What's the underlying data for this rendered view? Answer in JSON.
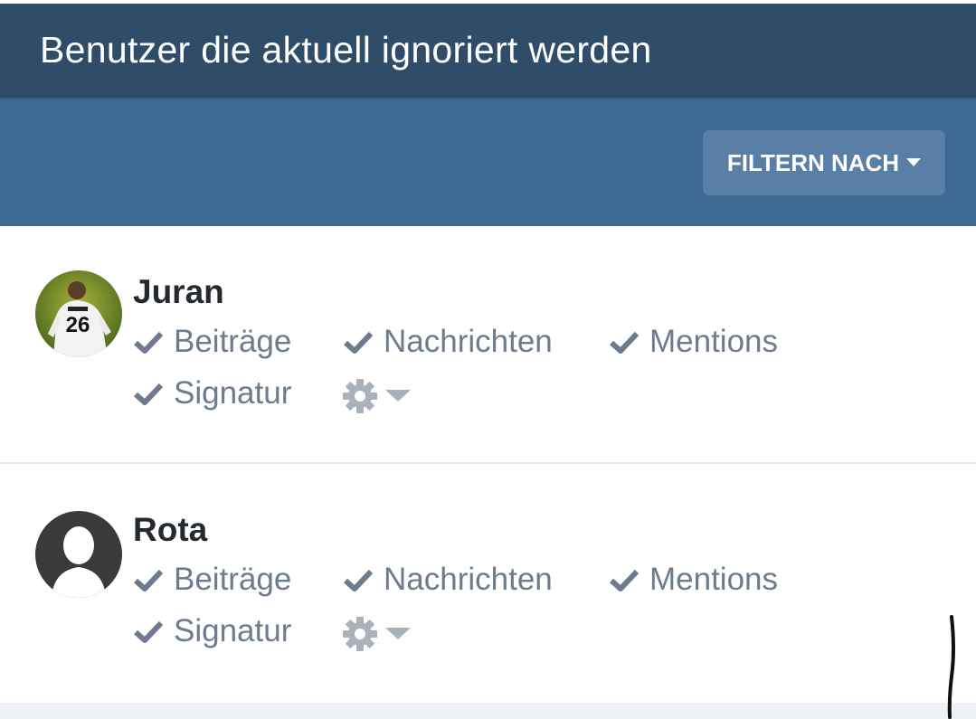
{
  "header": {
    "title": "Benutzer die aktuell ignoriert werden"
  },
  "toolbar": {
    "filter_label": "FILTERN NACH",
    "filter_icon": "caret-down-icon"
  },
  "users": [
    {
      "name": "Juran",
      "avatar": "photo-avatar",
      "prefs": {
        "posts": "Beiträge",
        "messages": "Nachrichten",
        "mentions": "Mentions",
        "signature": "Signatur"
      },
      "options_icon": "gear-icon"
    },
    {
      "name": "Rota",
      "avatar": "default-avatar",
      "prefs": {
        "posts": "Beiträge",
        "messages": "Nachrichten",
        "mentions": "Mentions",
        "signature": "Signatur"
      },
      "options_icon": "gear-icon"
    }
  ],
  "colors": {
    "header_bg": "#2f4d69",
    "toolbar_bg": "#3e6994",
    "button_bg": "#5a7fa6",
    "pref_text": "#6d7b8f",
    "username_text": "#252a31"
  }
}
